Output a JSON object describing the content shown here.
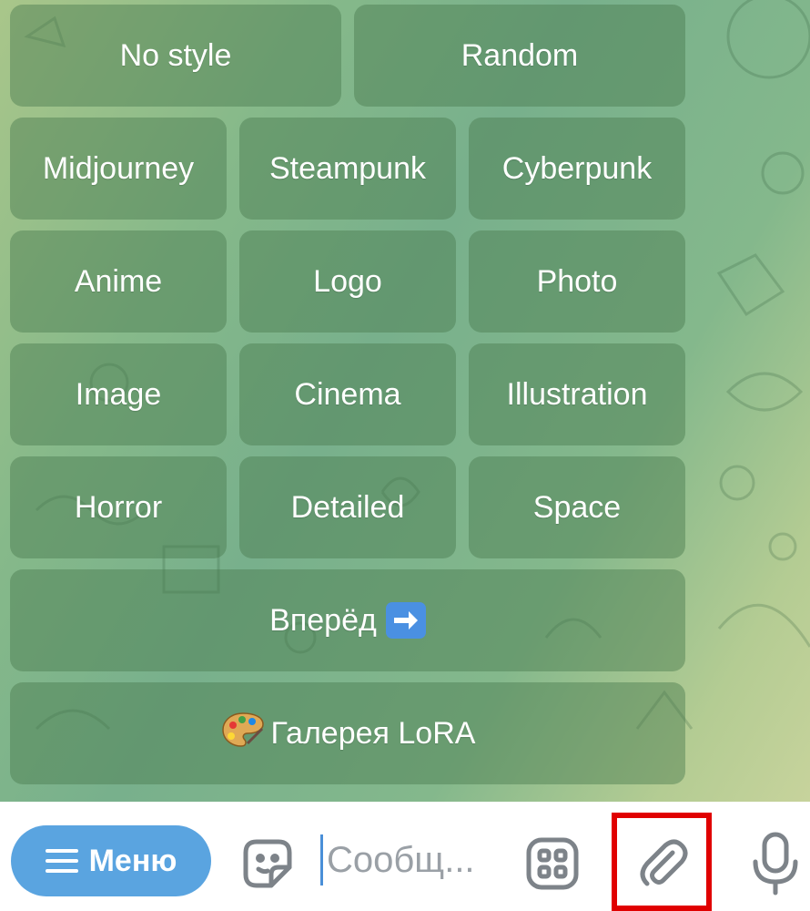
{
  "keyboard": {
    "rows": [
      [
        {
          "label": "No style"
        },
        {
          "label": "Random"
        }
      ],
      [
        {
          "label": "Midjourney"
        },
        {
          "label": "Steampunk"
        },
        {
          "label": "Cyberpunk"
        }
      ],
      [
        {
          "label": "Anime"
        },
        {
          "label": "Logo"
        },
        {
          "label": "Photo"
        }
      ],
      [
        {
          "label": "Image"
        },
        {
          "label": "Cinema"
        },
        {
          "label": "Illustration"
        }
      ],
      [
        {
          "label": "Horror"
        },
        {
          "label": "Detailed"
        },
        {
          "label": "Space"
        }
      ],
      [
        {
          "label": "Вперёд",
          "icon": "right-arrow-emoji"
        }
      ],
      [
        {
          "label": "Галерея LoRA",
          "icon": "palette-emoji"
        }
      ]
    ]
  },
  "composer": {
    "menu_label": "Меню",
    "placeholder": "Сообщ...",
    "icons": [
      "burger-icon",
      "sticker-icon",
      "bot-commands-icon",
      "attach-icon",
      "microphone-icon"
    ],
    "highlight_color": "#e00000",
    "accent": "#5aa4e0"
  }
}
